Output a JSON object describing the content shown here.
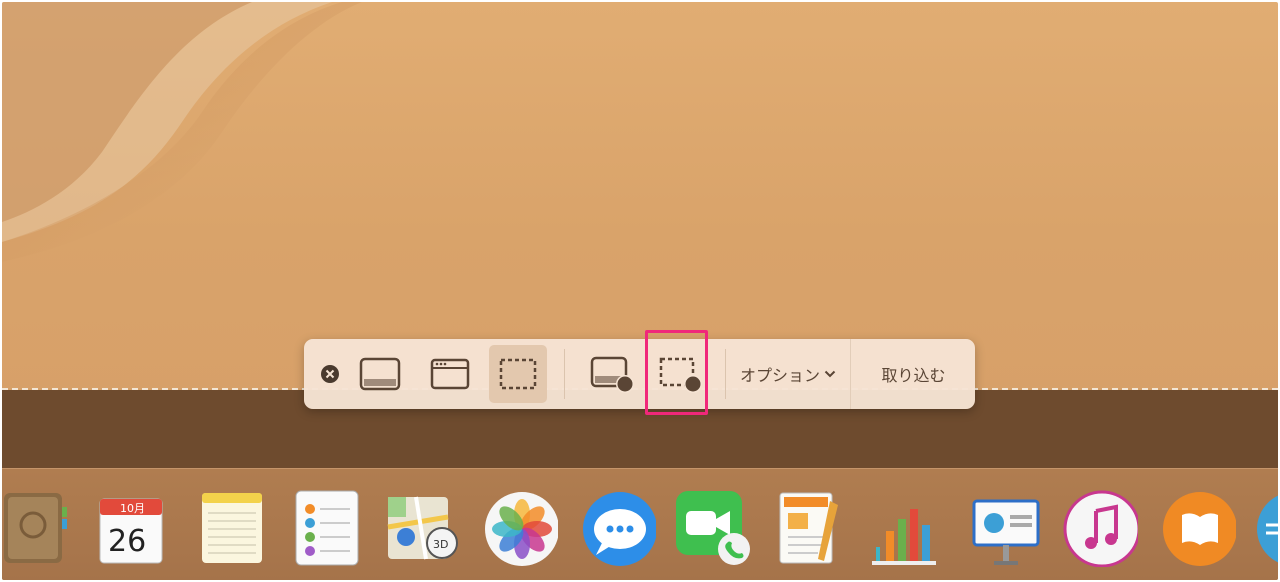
{
  "toolbar": {
    "close_icon": "close-circle-icon",
    "tools": [
      {
        "name": "capture-entire-screen",
        "icon": "screen-icon"
      },
      {
        "name": "capture-selected-window",
        "icon": "window-icon"
      },
      {
        "name": "capture-selected-portion",
        "icon": "dashed-selection-icon",
        "selected": true
      },
      {
        "name": "record-entire-screen",
        "icon": "screen-record-icon"
      },
      {
        "name": "record-selected-portion",
        "icon": "selection-record-icon",
        "highlighted": true
      }
    ],
    "options_label": "オプション",
    "capture_label": "取り込む"
  },
  "dock": {
    "calendar_month": "10月",
    "calendar_day": "26",
    "items": [
      "contacts-app-icon",
      "calendar-app-icon",
      "notes-app-icon",
      "reminders-app-icon",
      "maps-app-icon",
      "photos-app-icon",
      "messages-app-icon",
      "facetime-app-icon",
      "pages-app-icon",
      "numbers-app-icon",
      "keynote-app-icon",
      "itunes-app-icon",
      "books-app-icon",
      "system-app-icon"
    ]
  },
  "colors": {
    "highlight": "#f0287a",
    "toolbar_bg": "#f6e4d4",
    "icon": "#5a4535"
  }
}
